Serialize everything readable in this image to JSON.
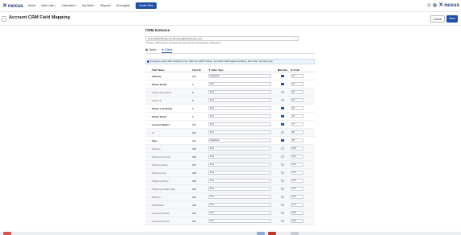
{
  "nav": {
    "logo": "nexus",
    "items": [
      "Home",
      "Web Lists",
      "Calendars",
      "My Stuff",
      "Reports",
      "AI Insights"
    ],
    "create_button": "Create Web",
    "right_logo": "nexus"
  },
  "header": {
    "title": "Account CRM Field Mapping",
    "cancel_label": "Cancel",
    "save_label": "Save"
  },
  "crm": {
    "section_title": "CRM Instance",
    "instance_value": "scorecard6745-dev-ed.develop.lightning.force.com",
    "hint": "Changing CRM instance will reload the page with the corresponding configuration."
  },
  "tabs": [
    "Tables",
    "Filters"
  ],
  "active_tab": "Filters",
  "info_text": "Configure search filter settings for the \"Add from CRM\" feature. Get which fields appear as filters, their order, and filter type.",
  "columns": {
    "name": "Field Name",
    "id": "Field ID",
    "type": "Filter Type",
    "visible": "Visible",
    "order": "Order"
  },
  "rows": [
    {
      "name": "Industry",
      "id": "303",
      "type": "Dropdown",
      "visible": true,
      "order": "10"
    },
    {
      "name": "Owner Email",
      "id": "0",
      "type": "Text",
      "visible": true,
      "order": "20"
    },
    {
      "name": "Owner First Name",
      "id": "0",
      "type": "Text",
      "visible": false,
      "order": "30"
    },
    {
      "name": "Owner Id",
      "id": "0",
      "type": "Text",
      "visible": false,
      "order": "40"
    },
    {
      "name": "Owner Last Name",
      "id": "0",
      "type": "Text",
      "visible": true,
      "order": "50"
    },
    {
      "name": "Owner Name",
      "id": "0",
      "type": "Text",
      "visible": true,
      "order": "60"
    },
    {
      "name": "Account Name *",
      "id": "301",
      "type": "Text",
      "visible": true,
      "order": "70"
    },
    {
      "name": "Id",
      "id": "302",
      "type": "Text",
      "visible": false,
      "order": "80"
    },
    {
      "name": "Type",
      "id": "304",
      "type": "Dropdown",
      "visible": true,
      "order": "90"
    },
    {
      "name": "Website",
      "id": "305",
      "type": "Text",
      "visible": false,
      "order": "100"
    },
    {
      "name": "Shipping Country",
      "id": "306",
      "type": "Text",
      "visible": false,
      "order": "110"
    },
    {
      "name": "Shipping State",
      "id": "307",
      "type": "Text",
      "visible": false,
      "order": "120"
    },
    {
      "name": "Shipping City",
      "id": "308",
      "type": "Text",
      "visible": false,
      "order": "130"
    },
    {
      "name": "Shipping Street",
      "id": "309",
      "type": "Text",
      "visible": false,
      "order": "140"
    },
    {
      "name": "Shipping Postal Code",
      "id": "310",
      "type": "Text",
      "visible": false,
      "order": "150"
    },
    {
      "name": "Division",
      "id": "316",
      "type": "Text",
      "visible": false,
      "order": "160"
    },
    {
      "name": "NDAStatus",
      "id": "318",
      "type": "Text",
      "visible": false,
      "order": "170"
    },
    {
      "name": "Account Product",
      "id": "320",
      "type": "Text",
      "visible": false,
      "order": "180"
    },
    {
      "name": "Account Product",
      "id": "321",
      "type": "Text",
      "visible": false,
      "order": "190"
    }
  ],
  "colors": {
    "accent": "#1f4ea8",
    "brand": "#1f3b73"
  }
}
